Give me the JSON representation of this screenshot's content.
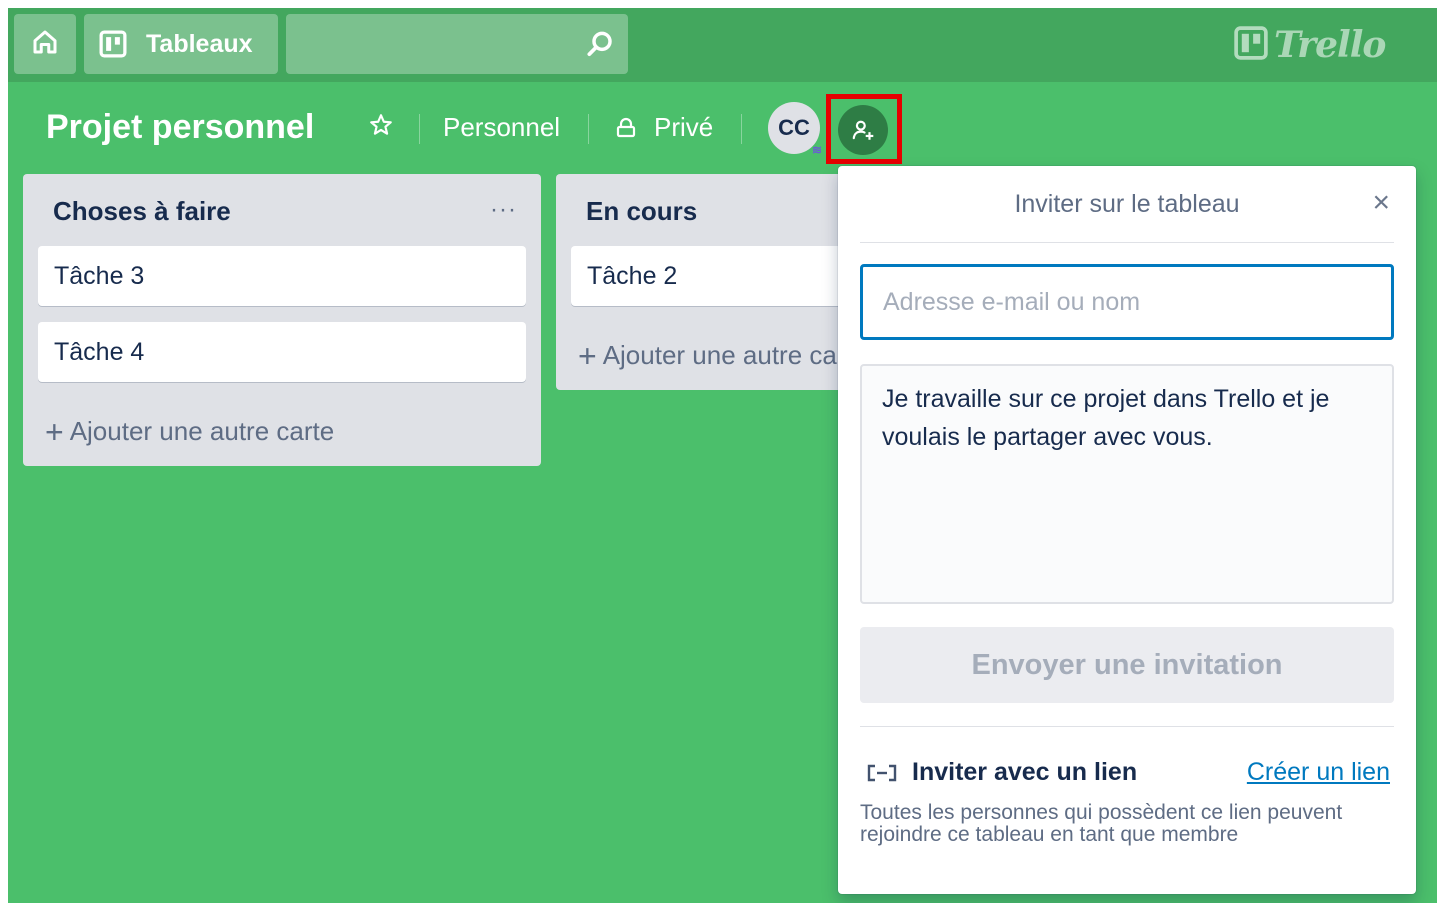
{
  "header": {
    "home_icon": "home-icon",
    "boards_label": "Tableaux",
    "boards_icon": "boards-icon",
    "search_icon": "search-icon",
    "logo_text": "Trello"
  },
  "board": {
    "title": "Projet personnel",
    "star_icon": "star-icon",
    "team_label": "Personnel",
    "visibility_label": "Privé",
    "visibility_icon": "lock-icon",
    "member_initials": "CC",
    "invite_icon": "add-member-icon"
  },
  "lists": [
    {
      "title": "Choses à faire",
      "menu_label": "···",
      "cards": [
        "Tâche 3",
        "Tâche 4"
      ],
      "add_card_label": "Ajouter une autre carte"
    },
    {
      "title": "En cours",
      "cards": [
        "Tâche 2"
      ],
      "add_card_label": "Ajouter une autre carte"
    }
  ],
  "invite_popover": {
    "title": "Inviter sur le tableau",
    "close_label": "×",
    "email_placeholder": "Adresse e-mail ou nom",
    "message": "Je travaille sur ce projet dans Trello et je voulais le partager avec vous.",
    "send_label": "Envoyer une invitation",
    "link_section_title": "Inviter avec un lien",
    "link_icon": "link-icon",
    "create_link_label": "Créer un lien",
    "link_description": "Toutes les personnes qui possèdent ce lien peuvent rejoindre ce tableau en tant que membre"
  },
  "colors": {
    "board_background": "#4bbf6b",
    "header_background": "#43a75e",
    "highlight_border": "#e60000",
    "primary_blue": "#0079bf"
  }
}
